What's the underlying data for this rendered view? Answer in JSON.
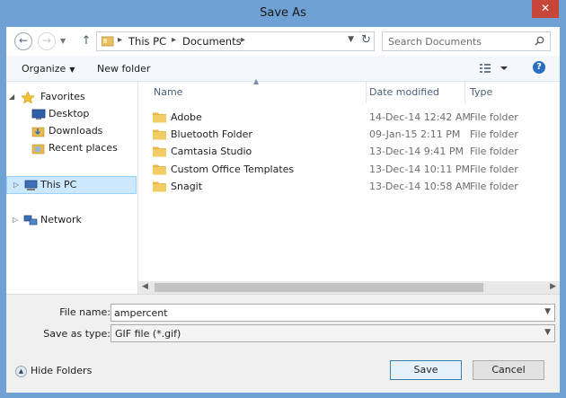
{
  "window": {
    "title": "Save As",
    "close_glyph": "✕"
  },
  "address_bar": {
    "crumbs": [
      "This PC",
      "Documents"
    ],
    "separator": "▸"
  },
  "search": {
    "placeholder": "Search Documents"
  },
  "toolbar": {
    "organize_label": "Organize",
    "new_folder_label": "New folder"
  },
  "nav_pane": {
    "favorites": "Favorites",
    "favorite_items": [
      "Desktop",
      "Downloads",
      "Recent places"
    ],
    "this_pc": "This PC",
    "network": "Network"
  },
  "columns": {
    "name": "Name",
    "date": "Date modified",
    "type": "Type"
  },
  "files": [
    {
      "name": "Adobe",
      "date": "14-Dec-14 12:42 AM",
      "type": "File folder"
    },
    {
      "name": "Bluetooth Folder",
      "date": "09-Jan-15 2:11 PM",
      "type": "File folder"
    },
    {
      "name": "Camtasia Studio",
      "date": "13-Dec-14 9:41 PM",
      "type": "File folder"
    },
    {
      "name": "Custom Office Templates",
      "date": "13-Dec-14 10:11 PM",
      "type": "File folder"
    },
    {
      "name": "Snagit",
      "date": "13-Dec-14 10:58 AM",
      "type": "File folder"
    }
  ],
  "form": {
    "file_name_label": "File name:",
    "file_name_value": "ampercent",
    "save_type_label": "Save as type:",
    "save_type_value": "GIF file (*.gif)"
  },
  "footer": {
    "hide_folders_label": "Hide Folders",
    "save_label": "Save",
    "cancel_label": "Cancel"
  },
  "colors": {
    "frame": "#6fa1d4",
    "close": "#c7463a",
    "selection": "#cce8ff",
    "folder": "#e8b94a"
  }
}
